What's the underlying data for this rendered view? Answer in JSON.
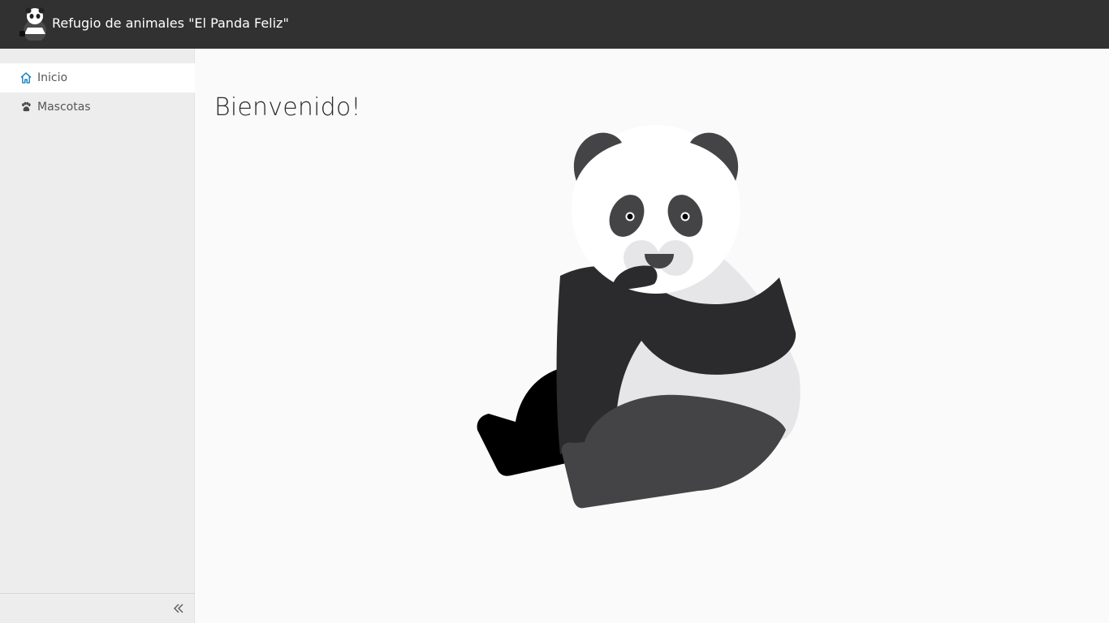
{
  "header": {
    "app_title": "Refugio de animales \"El Panda Feliz\"",
    "logo_icon": "panda-logo-icon",
    "background": "#313131"
  },
  "sidebar": {
    "items": [
      {
        "label": "Inicio",
        "icon": "home-icon",
        "active": true
      },
      {
        "label": "Mascotas",
        "icon": "paw-icon",
        "active": false
      }
    ],
    "collapse_icon": "double-chevron-left-icon"
  },
  "main": {
    "title": "Bienvenido!",
    "illustration": "panda-illustration"
  },
  "colors": {
    "accent": "#0079b8",
    "sidebar_bg": "#ededed",
    "content_bg": "#fafafa"
  }
}
